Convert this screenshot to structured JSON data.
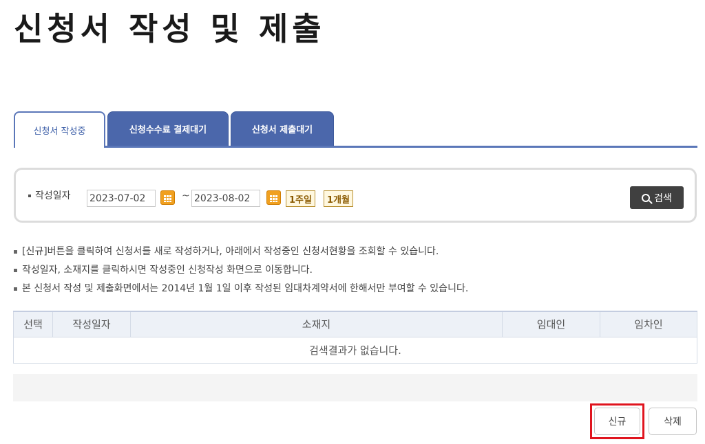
{
  "page_title": "신청서 작성 및 제출",
  "tabs": [
    {
      "label": "신청서 작성중",
      "active": true
    },
    {
      "label": "신청수수료 결제대기",
      "active": false
    },
    {
      "label": "신청서 제출대기",
      "active": false
    }
  ],
  "search": {
    "label": "작성일자",
    "date_from": "2023-07-02",
    "date_to": "2023-08-02",
    "separator": "~",
    "week_button": "1주일",
    "month_button": "1개월",
    "search_button": "검색"
  },
  "notes": [
    "[신규]버튼을 클릭하여 신청서를 새로 작성하거나, 아래에서 작성중인 신청서현황을 조회할 수 있습니다.",
    "작성일자, 소재지를 클릭하시면 작성중인 신청작성 화면으로 이동합니다.",
    "본 신청서 작성 및 제출화면에서는 2014년 1월 1일 이후 작성된 임대차계약서에 한해서만 부여할 수 있습니다."
  ],
  "table": {
    "headers": [
      "선택",
      "작성일자",
      "소재지",
      "임대인",
      "임차인"
    ],
    "empty_message": "검색결과가 없습니다."
  },
  "buttons": {
    "new": "신규",
    "delete": "삭제"
  },
  "colors": {
    "tab_blue": "#4b67ab",
    "highlight_red": "#e0141e",
    "calendar_orange": "#f0a020"
  }
}
